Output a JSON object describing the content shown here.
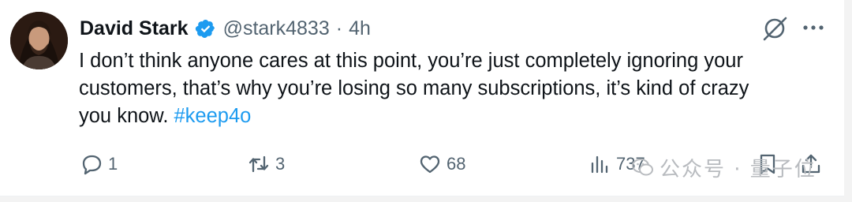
{
  "tweet": {
    "author": {
      "name": "David Stark",
      "handle": "@stark4833",
      "verified": true
    },
    "separator": "·",
    "time": "4h",
    "text_plain": "I don’t think anyone cares at this point, you’re just completely ignoring your\ncustomers, that’s why you’re losing so many subscriptions, it’s kind of crazy\nyou know. ",
    "hashtag": "#keep4o",
    "actions": {
      "replies": "1",
      "reposts": "3",
      "likes": "68",
      "views": "737"
    },
    "icons": [
      "verified-badge-icon",
      "grok-icon",
      "more-icon",
      "reply-icon",
      "repost-icon",
      "like-icon",
      "views-icon",
      "bookmark-icon",
      "share-icon"
    ],
    "colors": {
      "text": "#0f1419",
      "secondary": "#536471",
      "accent": "#1d9bf0"
    }
  },
  "watermark": {
    "text": "公众号 · 量子位"
  }
}
